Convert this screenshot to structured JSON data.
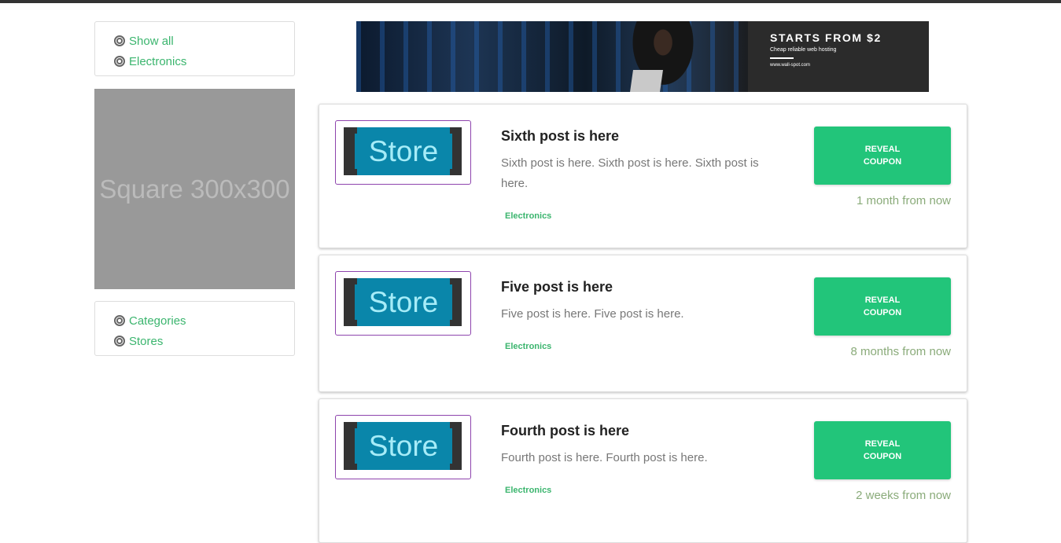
{
  "sidebar": {
    "filters": [
      {
        "label": "Show all"
      },
      {
        "label": "Electronics"
      }
    ],
    "ad_placeholder": "Square 300x300",
    "links": [
      {
        "label": "Categories"
      },
      {
        "label": "Stores"
      }
    ]
  },
  "banner": {
    "headline": "STARTS FROM $2",
    "subtitle": "Cheap reliable web hosting",
    "url": "www.wall-spot.com"
  },
  "posts": [
    {
      "logo_text": "Store",
      "title": "Sixth post is here",
      "description": "Sixth post is here. Sixth post is here. Sixth post is here.",
      "category": "Electronics",
      "button": "REVEAL COUPON",
      "expires": "1 month from now"
    },
    {
      "logo_text": "Store",
      "title": "Five post is here",
      "description": "Five post is here. Five post is here.",
      "category": "Electronics",
      "button": "REVEAL COUPON",
      "expires": "8 months from now"
    },
    {
      "logo_text": "Store",
      "title": "Fourth post is here",
      "description": "Fourth post is here. Fourth post is here.",
      "category": "Electronics",
      "button": "REVEAL COUPON",
      "expires": "2 weeks from now"
    }
  ],
  "colors": {
    "accent": "#22c57a",
    "link": "#3bb56e",
    "logo_border": "#8e44ad"
  }
}
